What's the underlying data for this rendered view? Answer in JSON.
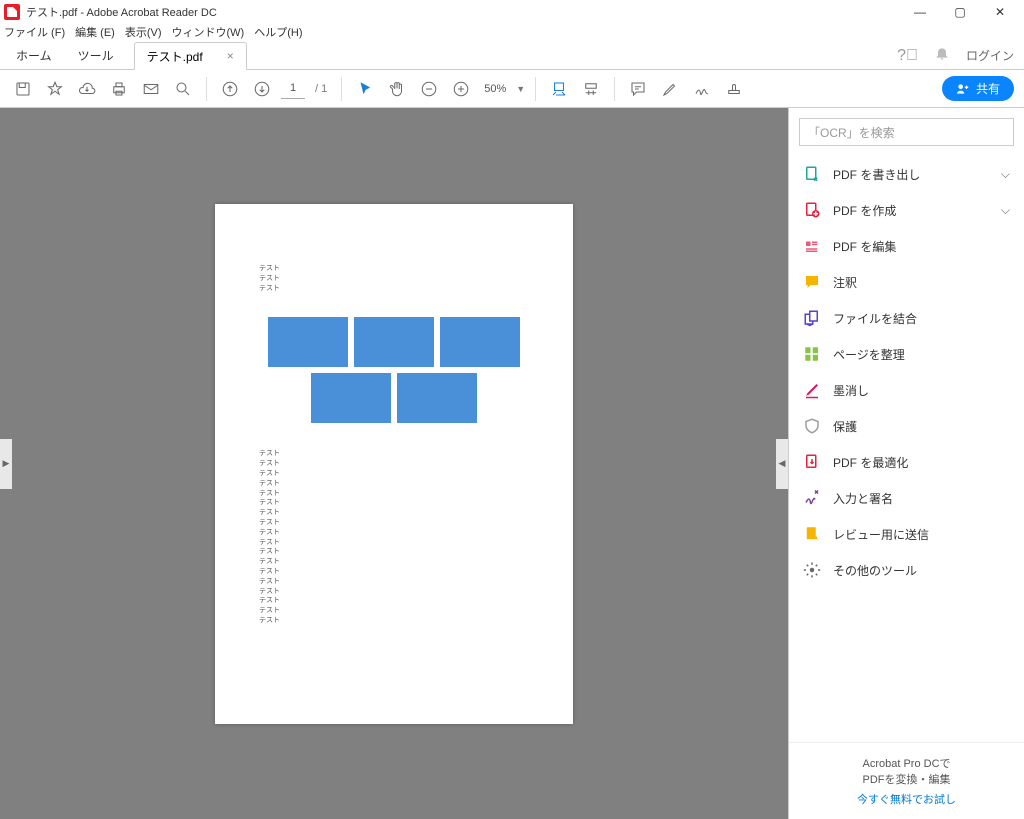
{
  "title": "テスト.pdf - Adobe Acrobat Reader DC",
  "menu": [
    "ファイル (F)",
    "編集 (E)",
    "表示(V)",
    "ウィンドウ(W)",
    "ヘルプ(H)"
  ],
  "tabs": {
    "home": "ホーム",
    "tools": "ツール",
    "file": "テスト.pdf",
    "login": "ログイン"
  },
  "toolbar": {
    "page_current": "1",
    "page_total": "/ 1",
    "zoom": "50%",
    "share": "共有"
  },
  "search_placeholder": "「OCR」を検索",
  "tools_panel": [
    {
      "label": "PDF を書き出し",
      "chevron": true
    },
    {
      "label": "PDF を作成",
      "chevron": true
    },
    {
      "label": "PDF を編集"
    },
    {
      "label": "注釈"
    },
    {
      "label": "ファイルを結合"
    },
    {
      "label": "ページを整理"
    },
    {
      "label": "墨消し"
    },
    {
      "label": "保護"
    },
    {
      "label": "PDF を最適化"
    },
    {
      "label": "入力と署名"
    },
    {
      "label": "レビュー用に送信"
    },
    {
      "label": "その他のツール"
    }
  ],
  "promo": {
    "line1": "Acrobat Pro DCで",
    "line2": "PDFを変換・編集",
    "link": "今すぐ無料でお試し"
  },
  "doc": {
    "text_top": [
      "テスト",
      "テスト",
      "テスト"
    ],
    "text_bottom": [
      "テスト",
      "テスト",
      "テスト",
      "テスト",
      "テスト",
      "テスト",
      "テスト",
      "テスト",
      "テスト",
      "テスト",
      "テスト",
      "テスト",
      "テスト",
      "テスト",
      "テスト",
      "テスト",
      "テスト",
      "テスト"
    ]
  },
  "tool_icons": {
    "colors": {
      "export": "#1fa5a0",
      "create": "#e6233e",
      "edit": "#e85a7a",
      "comment": "#f5b400",
      "combine": "#5b3fd1",
      "organize": "#8bc34a",
      "redact": "#d81b60",
      "protect": "#9e9e9e",
      "optimize": "#e6233e",
      "sign": "#7b3fa0",
      "review": "#f5b400",
      "more": "#6a6a6a"
    }
  }
}
